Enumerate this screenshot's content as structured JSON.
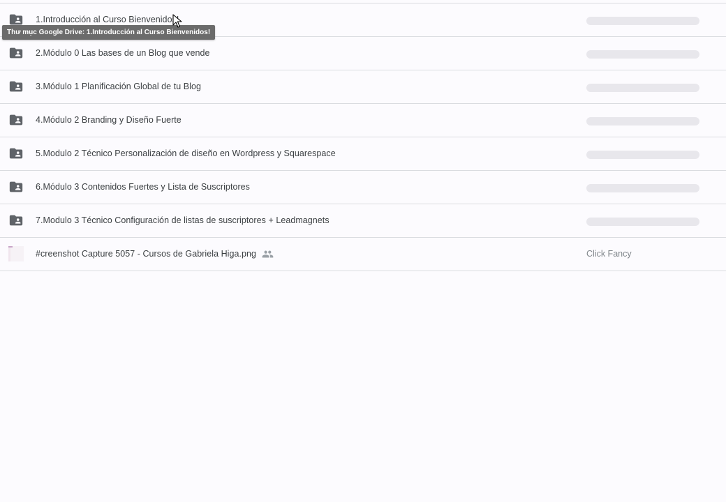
{
  "tooltip": {
    "text": "Thư mục Google Drive: 1.Introducción al Curso Bienvenidos!"
  },
  "files": [
    {
      "name": "1.Introducción al Curso Bienvenidos!",
      "type": "shared-folder",
      "icon": "shared-folder-icon"
    },
    {
      "name": "2.Módulo 0 Las bases de un Blog que vende",
      "type": "shared-folder",
      "icon": "shared-folder-icon"
    },
    {
      "name": "3.Módulo 1 Planificación Global de tu Blog",
      "type": "shared-folder",
      "icon": "shared-folder-icon"
    },
    {
      "name": "4.Módulo 2 Branding y Diseño Fuerte",
      "type": "shared-folder",
      "icon": "shared-folder-icon"
    },
    {
      "name": "5.Modulo 2 Técnico Personalización de diseño en Wordpress y Squarespace",
      "type": "shared-folder",
      "icon": "shared-folder-icon"
    },
    {
      "name": "6.Módulo 3 Contenidos Fuertes y Lista de Suscriptores",
      "type": "shared-folder",
      "icon": "shared-folder-icon"
    },
    {
      "name": "7.Modulo 3 Técnico Configuración de listas de suscriptores + Leadmagnets",
      "type": "shared-folder",
      "icon": "shared-folder-icon"
    },
    {
      "name": "#creenshot Capture 5057 - Cursos de Gabriela Higa.png",
      "type": "image-file",
      "icon": "image-thumbnail",
      "shared_icon": "people-icon",
      "owner": "Click Fancy"
    }
  ],
  "colors": {
    "background": "#fcfbfe",
    "divider": "#dadce0",
    "folder_icon": "#5f6368",
    "text": "#3c4043",
    "secondary_text": "#80868b",
    "placeholder": "#e8e7ec",
    "tooltip_bg": "#6b6b6b"
  }
}
